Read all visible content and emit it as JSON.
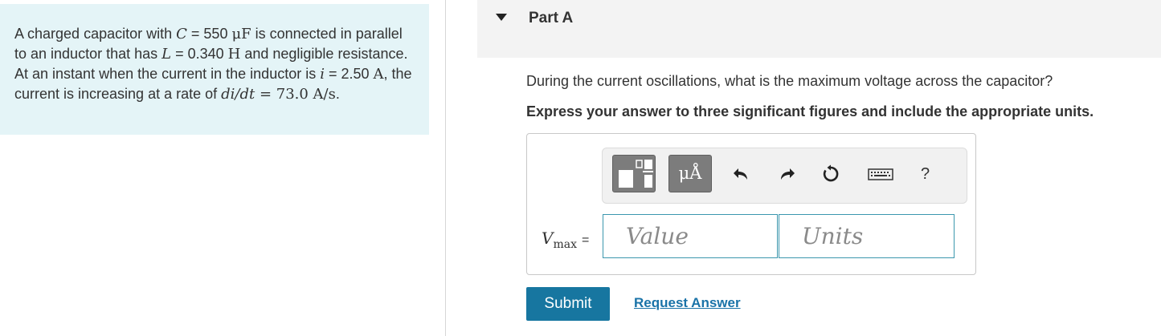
{
  "problem": {
    "t1": "A charged capacitor with ",
    "C_sym": "C",
    "t2": " = 550 ",
    "uF_unit": "μF",
    "t3": " is connected in parallel to an inductor that has ",
    "L_sym": "L",
    "t4": " = 0.340 ",
    "H_unit": "H",
    "t5": " and negligible resistance. At an instant when the current in the inductor is ",
    "i_sym": "i",
    "t6": " = 2.50 ",
    "A_unit": "A",
    "t7": ", the current is increasing at a rate of ",
    "didt_sym": "di/dt",
    "didt_eq": " = 73.0 A/s",
    "t8": "."
  },
  "part": {
    "title": "Part A",
    "question": "During the current oscillations, what is the maximum voltage across the capacitor?",
    "instruction": "Express your answer to three significant figures and include the appropriate units."
  },
  "toolbar": {
    "units_label": "μÅ",
    "help_label": "?"
  },
  "answer": {
    "var_name": "V",
    "var_sub": "max",
    "equals": "=",
    "value_placeholder": "Value",
    "units_placeholder": "Units"
  },
  "actions": {
    "submit_label": "Submit",
    "request_label": "Request Answer"
  }
}
